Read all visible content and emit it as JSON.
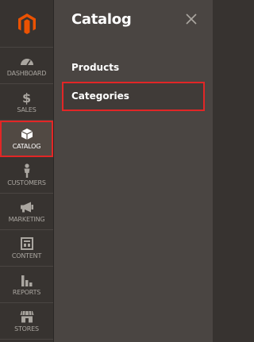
{
  "sidebar": {
    "items": [
      {
        "label": "DASHBOARD",
        "icon": "gauge-icon"
      },
      {
        "label": "SALES",
        "icon": "dollar-icon"
      },
      {
        "label": "CATALOG",
        "icon": "box-icon"
      },
      {
        "label": "CUSTOMERS",
        "icon": "person-icon"
      },
      {
        "label": "MARKETING",
        "icon": "megaphone-icon"
      },
      {
        "label": "CONTENT",
        "icon": "layout-icon"
      },
      {
        "label": "REPORTS",
        "icon": "bar-chart-icon"
      },
      {
        "label": "STORES",
        "icon": "storefront-icon"
      }
    ]
  },
  "panel": {
    "title": "Catalog",
    "items": [
      {
        "label": "Products"
      },
      {
        "label": "Categories"
      }
    ]
  },
  "colors": {
    "sidebar_bg": "#373330",
    "panel_bg": "#4a4542",
    "highlight": "#e22626",
    "logo": "#eb5202"
  }
}
